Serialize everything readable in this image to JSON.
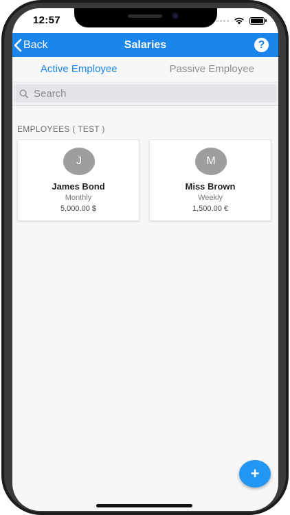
{
  "status": {
    "time": "12:57"
  },
  "navbar": {
    "back_label": "Back",
    "title": "Salaries",
    "help_glyph": "?"
  },
  "tabs": [
    {
      "label": "Active Employee",
      "active": true
    },
    {
      "label": "Passive Employee",
      "active": false
    }
  ],
  "search": {
    "placeholder": "Search",
    "value": ""
  },
  "section": {
    "header": "EMPLOYEES ( TEST )"
  },
  "employees": [
    {
      "initial": "J",
      "name": "James Bond",
      "period": "Monthly",
      "amount": "5,000.00 $"
    },
    {
      "initial": "M",
      "name": "Miss Brown",
      "period": "Weekly",
      "amount": "1,500.00 €"
    }
  ],
  "fab": {
    "label": "+"
  },
  "colors": {
    "accent": "#1a86ec",
    "avatar": "#9e9e9e",
    "fab": "#2196f3"
  }
}
